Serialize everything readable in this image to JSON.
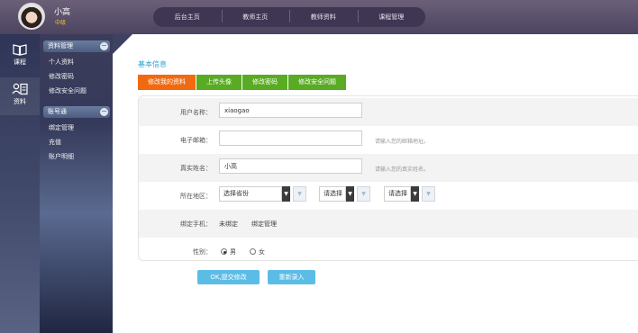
{
  "user": {
    "name": "小高",
    "level": "中级"
  },
  "topnav": [
    "后台主页",
    "教师主页",
    "教师资料",
    "课程管理"
  ],
  "rail": [
    {
      "label": "课程",
      "icon": "book-icon"
    },
    {
      "label": "资料",
      "icon": "user-card-icon"
    }
  ],
  "submenu": {
    "groups": [
      {
        "title": "资料管理",
        "toggle": "−",
        "items": [
          "个人资料",
          "修改密码",
          "修改安全问题"
        ]
      },
      {
        "title": "账号通",
        "toggle": "−",
        "items": [
          "绑定管理",
          "充值",
          "账户明细"
        ]
      }
    ]
  },
  "section_title": "基本信息",
  "tabs": [
    "修改我的资料",
    "上传头像",
    "修改密码",
    "修改安全问题"
  ],
  "form": {
    "username": {
      "label": "用户名称：",
      "value": "xiaogao"
    },
    "email": {
      "label": "电子邮箱：",
      "value": "",
      "hint": "请输入您的邮箱地址。"
    },
    "realname": {
      "label": "真实姓名：",
      "value": "小高",
      "hint": "请输入您的真实姓名。"
    },
    "region": {
      "label": "所在地区：",
      "province": "选择省份",
      "city": "请选择",
      "district": "请选择"
    },
    "phone": {
      "label": "绑定手机：",
      "status": "未绑定",
      "manage": "绑定管理"
    },
    "gender": {
      "label": "性别：",
      "male": "男",
      "female": "女",
      "selected": "男"
    }
  },
  "buttons": {
    "submit": "OK,提交修改",
    "reset": "重新录入"
  },
  "colors": {
    "accent_tab": "#f26a10",
    "tab": "#5aab24",
    "button": "#5bbde6",
    "section_title": "#2a9fd6"
  }
}
